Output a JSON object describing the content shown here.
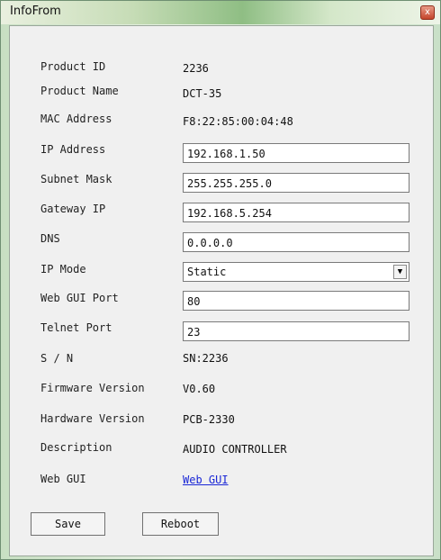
{
  "window": {
    "title": "InfoFrom",
    "close_glyph": "x"
  },
  "fields": {
    "product_id": {
      "label": "Product ID",
      "value": "2236"
    },
    "product_name": {
      "label": "Product Name",
      "value": "DCT-35"
    },
    "mac_address": {
      "label": "MAC Address",
      "value": "F8:22:85:00:04:48"
    },
    "ip_address": {
      "label": "IP Address",
      "value": "192.168.1.50"
    },
    "subnet_mask": {
      "label": "Subnet Mask",
      "value": "255.255.255.0"
    },
    "gateway_ip": {
      "label": "Gateway IP",
      "value": "192.168.5.254"
    },
    "dns": {
      "label": "DNS",
      "value": "0.0.0.0"
    },
    "ip_mode": {
      "label": "IP Mode",
      "value": "Static"
    },
    "web_gui_port": {
      "label": "Web GUI Port",
      "value": "80"
    },
    "telnet_port": {
      "label": "Telnet Port",
      "value": "23"
    },
    "serial_number": {
      "label": "S / N",
      "value": "SN:2236"
    },
    "firmware_version": {
      "label": "Firmware Version",
      "value": "V0.60"
    },
    "hardware_version": {
      "label": "Hardware Version",
      "value": "PCB-2330"
    },
    "description": {
      "label": "Description",
      "value": "AUDIO CONTROLLER"
    },
    "web_gui": {
      "label": "Web GUI",
      "link_text": "Web GUI"
    }
  },
  "buttons": {
    "save": "Save",
    "reboot": "Reboot"
  },
  "icons": {
    "close": "close-icon",
    "dropdown": "chevron-down-icon"
  },
  "colors": {
    "link": "#1a27d6",
    "titlebar_accent": "#8fbe84",
    "close_button": "#c4452c"
  }
}
